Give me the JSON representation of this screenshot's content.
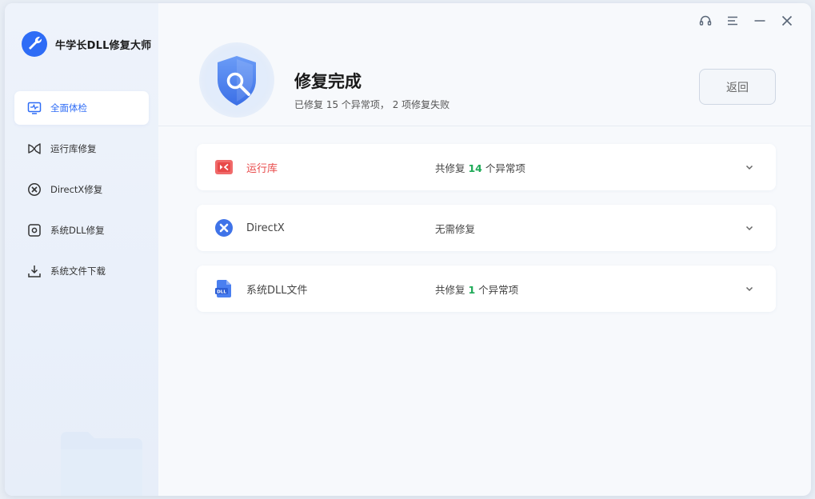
{
  "app": {
    "name": "牛学长DLL修复大师"
  },
  "sidebar": {
    "items": [
      {
        "label": "全面体检",
        "icon": "monitor-pulse-icon",
        "active": true
      },
      {
        "label": "运行库修复",
        "icon": "runtime-icon",
        "active": false
      },
      {
        "label": "DirectX修复",
        "icon": "directx-icon",
        "active": false
      },
      {
        "label": "系统DLL修复",
        "icon": "system-dll-icon",
        "active": false
      },
      {
        "label": "系统文件下载",
        "icon": "download-icon",
        "active": false
      }
    ]
  },
  "window_controls": {
    "icons": [
      "headset-icon",
      "menu-icon",
      "minimize-icon",
      "close-icon"
    ]
  },
  "header": {
    "title": "修复完成",
    "subtitle": "已修复 15 个异常项， 2 项修复失败",
    "back_label": "返回"
  },
  "results": [
    {
      "name": "运行库",
      "icon": "runtime-icon",
      "status_prefix": "共修复 ",
      "status_count": "14",
      "status_suffix": " 个异常项",
      "name_color": "#e84a4a"
    },
    {
      "name": "DirectX",
      "icon": "directx-icon",
      "status_prefix": "无需修复",
      "status_count": "",
      "status_suffix": "",
      "name_color": "#444444"
    },
    {
      "name": "系统DLL文件",
      "icon": "dll-file-icon",
      "status_prefix": "共修复 ",
      "status_count": "1",
      "status_suffix": " 个异常项",
      "name_color": "#444444"
    }
  ],
  "colors": {
    "accent": "#2e6cf6",
    "success": "#1faa58",
    "error": "#e84a4a"
  }
}
